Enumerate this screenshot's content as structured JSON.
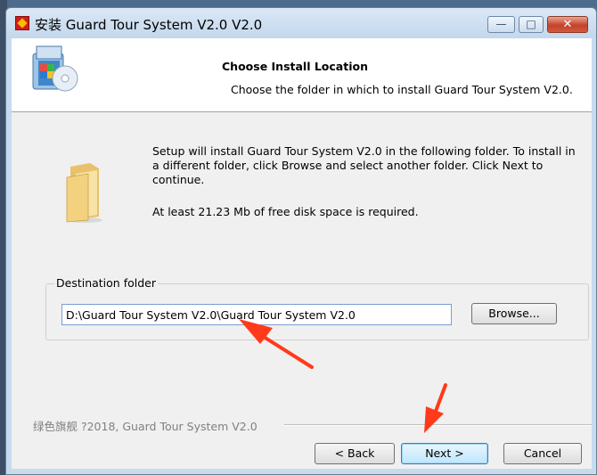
{
  "window": {
    "title": "安装 Guard Tour System V2.0 V2.0",
    "controls": {
      "minimize": "—",
      "maximize": "□",
      "close": "✕"
    }
  },
  "header": {
    "title": "Choose Install Location",
    "subtitle": "Choose the folder in which to install Guard Tour System V2.0."
  },
  "body": {
    "description": "Setup will install Guard Tour System V2.0 in the following folder. To install in a different folder, click Browse and select another folder. Click Next to continue.",
    "space_required": "At least 21.23 Mb of free disk space is required.",
    "destination_label": "Destination folder",
    "destination_value": "D:\\Guard Tour System V2.0\\Guard Tour System V2.0",
    "browse_label": "Browse..."
  },
  "footer": {
    "brand": "绿色旗舰 ?2018, Guard Tour System V2.0",
    "back_label": "< Back",
    "next_label": "Next >",
    "cancel_label": "Cancel"
  },
  "colors": {
    "title_bar": "#c3d7ec",
    "annotation_arrow": "#ff3a1a",
    "close_button": "#c4432b"
  },
  "icons": [
    "installer-disc-icon",
    "folder-icon",
    "app-icon",
    "annotation-arrow-icon"
  ]
}
